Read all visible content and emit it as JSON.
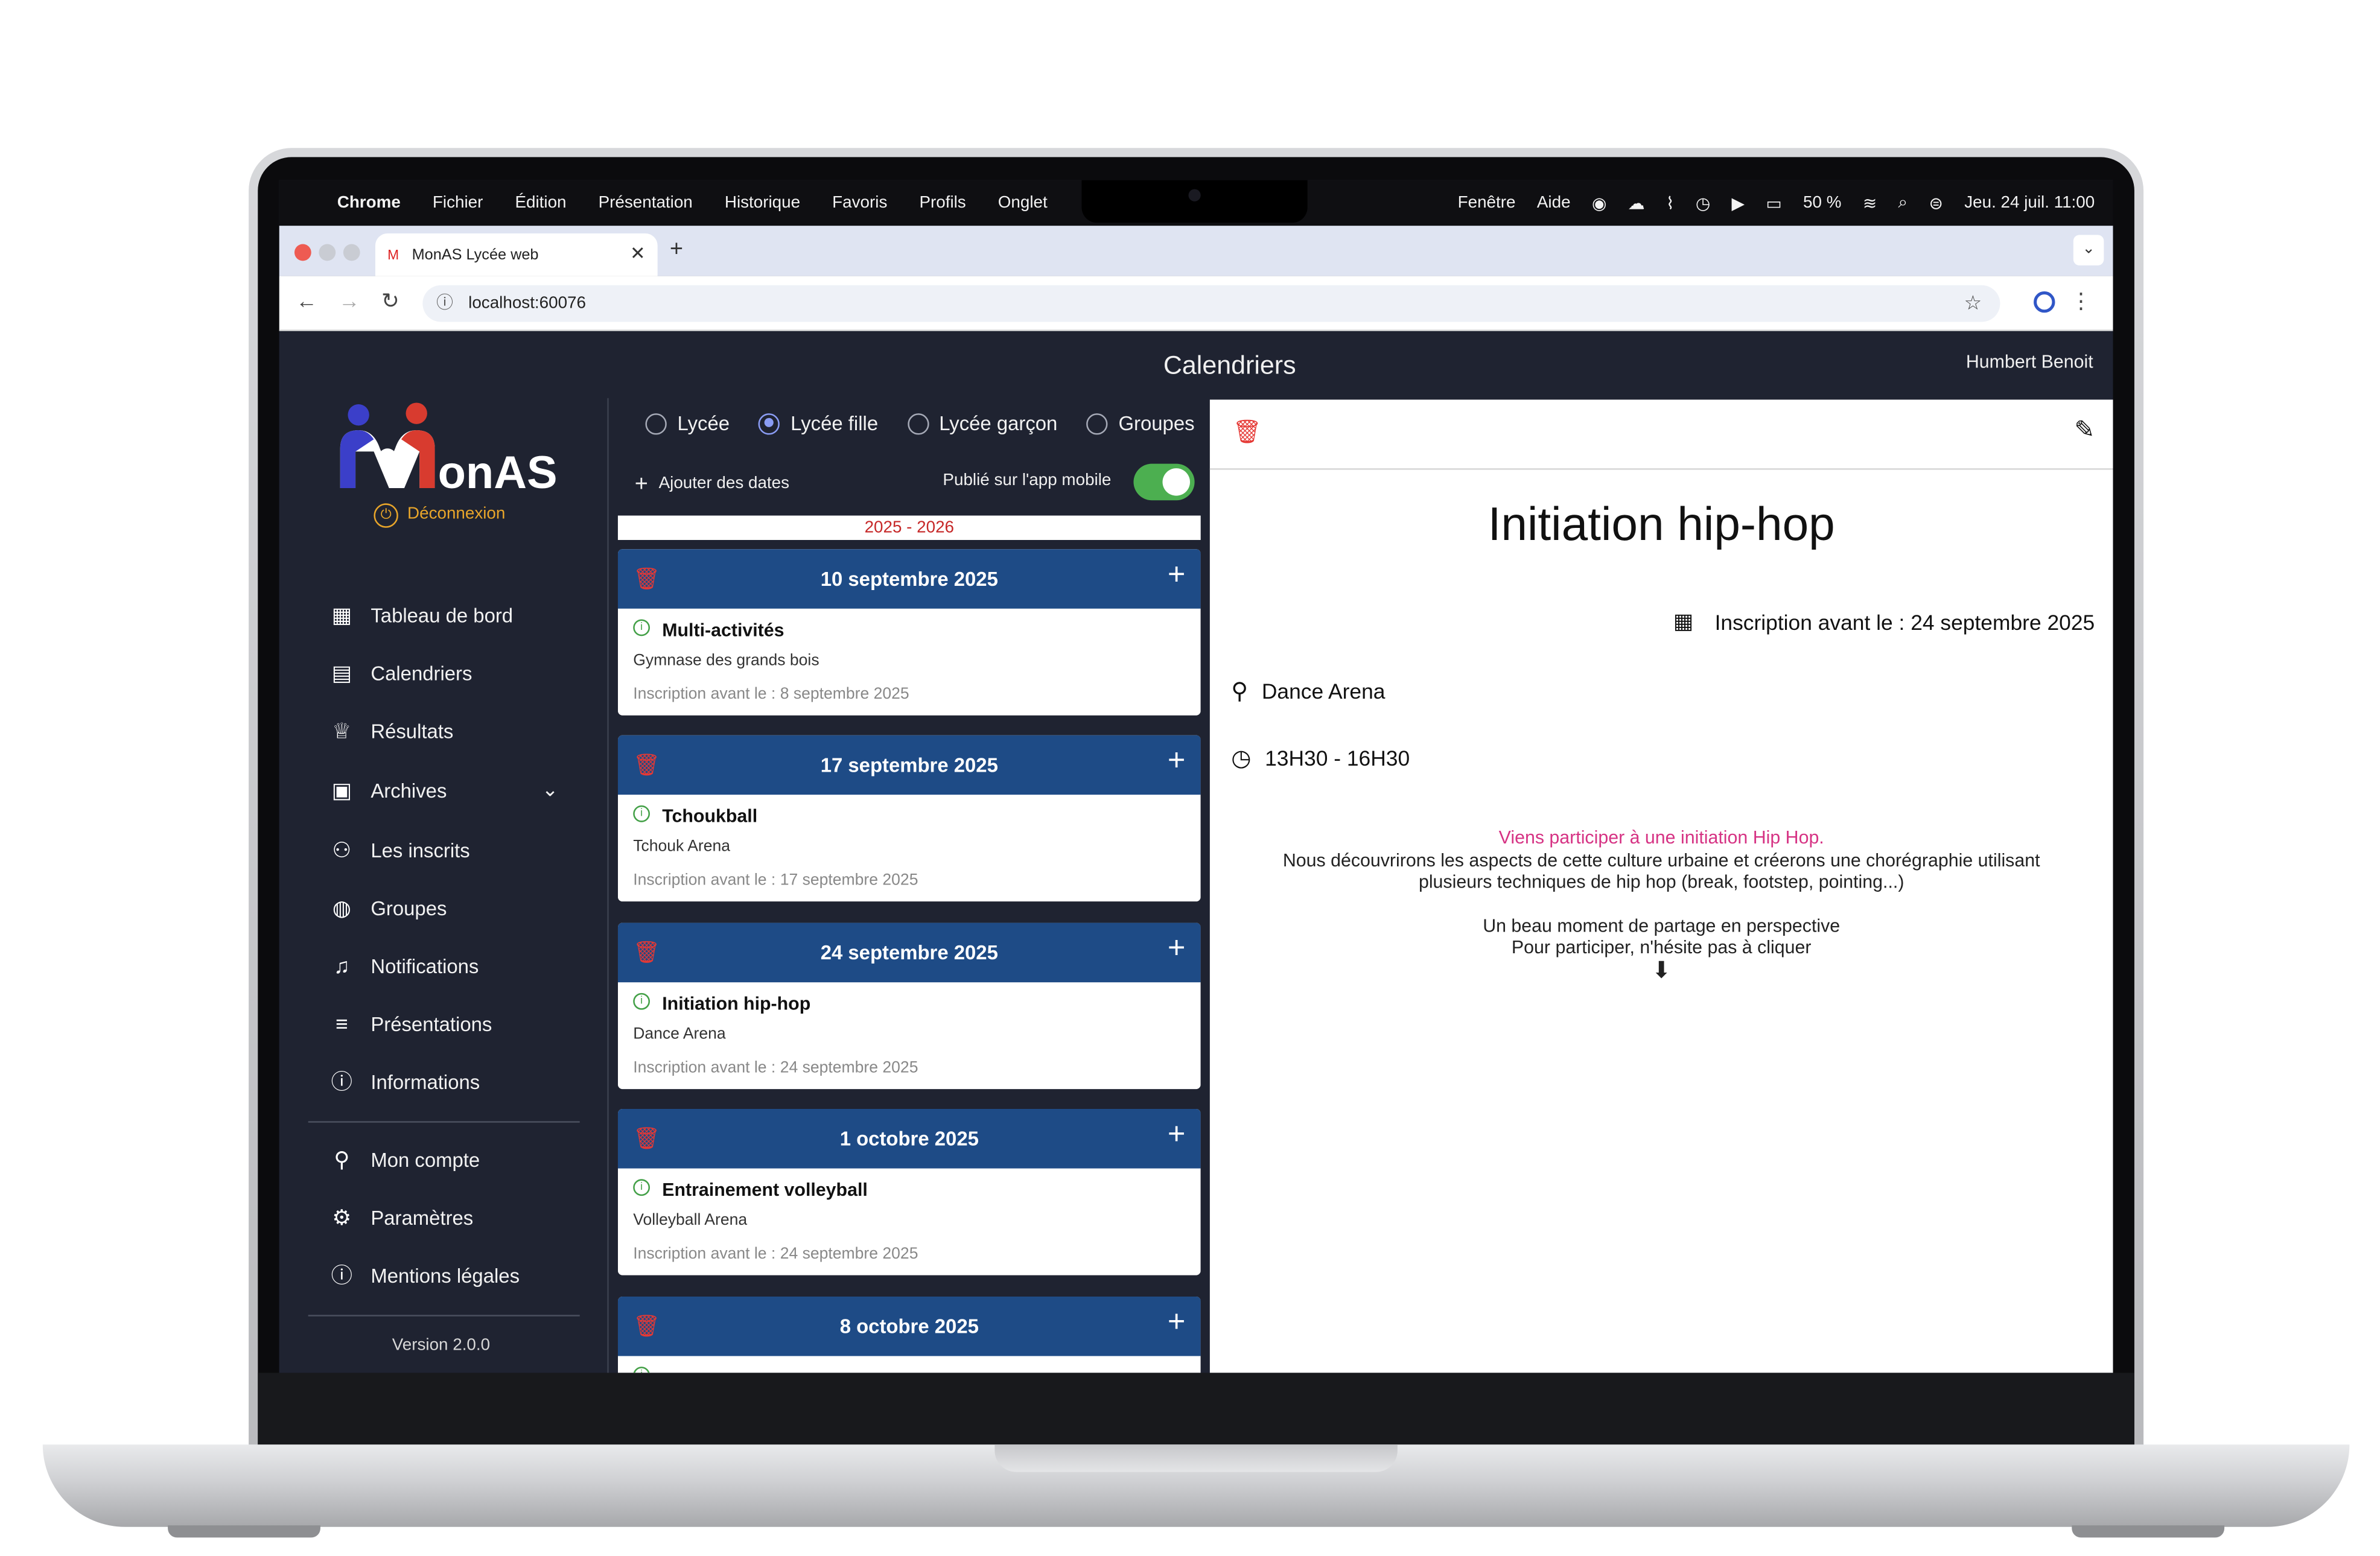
{
  "menubar": {
    "app": "Chrome",
    "items": [
      "Fichier",
      "Édition",
      "Présentation",
      "Historique",
      "Favoris",
      "Profils",
      "Onglet"
    ],
    "right_items": [
      "Fenêtre",
      "Aide"
    ],
    "battery": "50 %",
    "datetime": "Jeu. 24 juil.  11:00"
  },
  "browser": {
    "tab_title": "MonAS Lycée web",
    "url": "localhost:60076"
  },
  "app": {
    "title": "Calendriers",
    "user": "Humbert Benoit",
    "logo_text": "onAS",
    "logout": "Déconnexion",
    "version": "Version 2.0.0",
    "nav": [
      {
        "label": "Tableau de bord",
        "icon": "dashboard-icon"
      },
      {
        "label": "Calendriers",
        "icon": "calendar-icon"
      },
      {
        "label": "Résultats",
        "icon": "trophy-icon"
      },
      {
        "label": "Archives",
        "icon": "archive-icon"
      },
      {
        "label": "Les inscrits",
        "icon": "people-icon"
      },
      {
        "label": "Groupes",
        "icon": "volleyball-icon"
      },
      {
        "label": "Notifications",
        "icon": "bell-icon"
      },
      {
        "label": "Présentations",
        "icon": "align-center-icon"
      },
      {
        "label": "Informations",
        "icon": "info-icon"
      }
    ],
    "nav_bottom": [
      {
        "label": "Mon compte",
        "icon": "person-icon"
      },
      {
        "label": "Paramètres",
        "icon": "gear-icon"
      },
      {
        "label": "Mentions légales",
        "icon": "info-icon"
      }
    ]
  },
  "filters": {
    "options": [
      "Lycée",
      "Lycée fille",
      "Lycée garçon",
      "Groupes"
    ],
    "selected": "Lycée fille",
    "add_dates": "Ajouter des dates",
    "publish_label": "Publié sur l'app mobile",
    "publish_on": true
  },
  "season": "2025 - 2026",
  "events": [
    {
      "date": "10 septembre 2025",
      "name": "Multi-activités",
      "location": "Gymnase des grands bois",
      "deadline_label": "Inscription avant le :",
      "deadline": "8 septembre 2025"
    },
    {
      "date": "17 septembre 2025",
      "name": "Tchoukball",
      "location": "Tchouk Arena",
      "deadline_label": "Inscription avant le :",
      "deadline": "17 septembre 2025"
    },
    {
      "date": "24 septembre 2025",
      "name": "Initiation hip-hop",
      "location": "Dance Arena",
      "deadline_label": "Inscription avant le :",
      "deadline": "24 septembre 2025"
    },
    {
      "date": "1 octobre 2025",
      "name": "Entrainement volleyball",
      "location": "Volleyball Arena",
      "deadline_label": "Inscription avant le :",
      "deadline": "24 septembre 2025"
    },
    {
      "date": "8 octobre 2025",
      "name": "",
      "location": "",
      "deadline_label": "",
      "deadline": ""
    }
  ],
  "detail": {
    "title": "Initiation hip-hop",
    "registration": "Inscription avant le : 24 septembre 2025",
    "location": "Dance Arena",
    "time": "13H30 - 16H30",
    "desc_highlight": "Viens participer à une initiation Hip Hop.",
    "desc_line1": "Nous découvrirons les aspects de cette culture urbaine et créerons une chorégraphie utilisant",
    "desc_line2": "plusieurs techniques de hip hop (break, footstep, pointing...)",
    "desc_line3": "Un beau moment de partage en perspective",
    "desc_line4": "Pour participer, n'hésite pas à cliquer",
    "arrow": "⬇"
  },
  "colors": {
    "app_bg": "#1f2331",
    "card_header": "#1e4b86",
    "accent_orange": "#e8a52a",
    "delete_red": "#e53935",
    "toggle_green": "#4caf50",
    "highlight_pink": "#d63384"
  }
}
